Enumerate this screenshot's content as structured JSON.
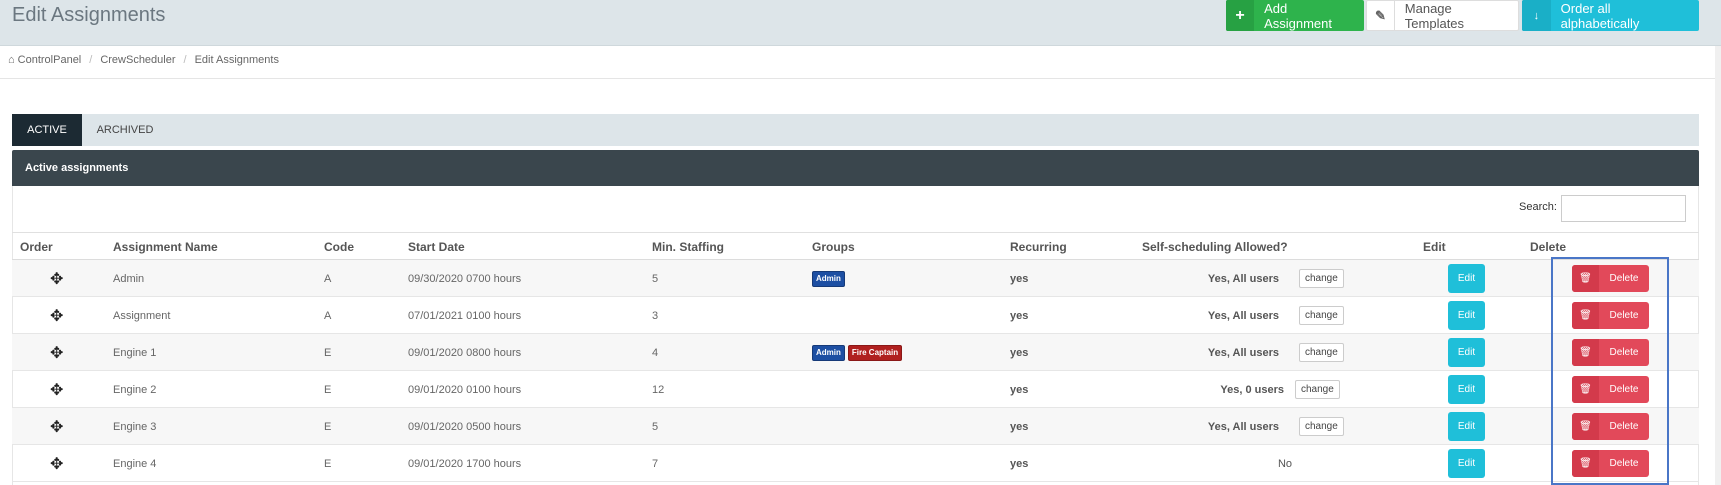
{
  "header": {
    "title": "Edit Assignments",
    "buttons": {
      "add_label": "Add Assignment",
      "manage_label": "Manage Templates",
      "order_label": "Order all alphabetically"
    }
  },
  "breadcrumb": [
    "ControlPanel",
    "CrewScheduler",
    "Edit Assignments"
  ],
  "tabs": [
    {
      "label": "ACTIVE",
      "active": true
    },
    {
      "label": "ARCHIVED",
      "active": false
    }
  ],
  "panel": {
    "title": "Active assignments",
    "search_label": "Search:",
    "search_value": ""
  },
  "table": {
    "columns": [
      "Order",
      "Assignment Name",
      "Code",
      "Start Date",
      "Min. Staffing",
      "Groups",
      "Recurring",
      "Self-scheduling Allowed?",
      "Edit",
      "Delete"
    ],
    "rows": [
      {
        "name": "Admin",
        "code": "A",
        "start": "09/30/2020 0700 hours",
        "staffing": "5",
        "groups": [
          "Admin"
        ],
        "recurring": "yes",
        "self": "Yes, All users",
        "change": "change",
        "edit": "Edit",
        "delete": "Delete"
      },
      {
        "name": "Assignment",
        "code": "A",
        "start": "07/01/2021 0100 hours",
        "staffing": "3",
        "groups": [],
        "recurring": "yes",
        "self": "Yes, All users",
        "change": "change",
        "edit": "Edit",
        "delete": "Delete"
      },
      {
        "name": "Engine 1",
        "code": "E",
        "start": "09/01/2020 0800 hours",
        "staffing": "4",
        "groups": [
          "Admin",
          "Fire Captain"
        ],
        "recurring": "yes",
        "self": "Yes, All users",
        "change": "change",
        "edit": "Edit",
        "delete": "Delete"
      },
      {
        "name": "Engine 2",
        "code": "E",
        "start": "09/01/2020 0100 hours",
        "staffing": "12",
        "groups": [],
        "recurring": "yes",
        "self": "Yes, 0 users",
        "change": "change",
        "edit": "Edit",
        "delete": "Delete"
      },
      {
        "name": "Engine 3",
        "code": "E",
        "start": "09/01/2020 0500 hours",
        "staffing": "5",
        "groups": [],
        "recurring": "yes",
        "self": "Yes, All users",
        "change": "change",
        "edit": "Edit",
        "delete": "Delete"
      },
      {
        "name": "Engine 4",
        "code": "E",
        "start": "09/01/2020 1700 hours",
        "staffing": "7",
        "groups": [],
        "recurring": "yes",
        "self": "No",
        "change": "",
        "edit": "Edit",
        "delete": "Delete"
      }
    ]
  },
  "colors": {
    "green": "#2eb34c",
    "cyan": "#1fbfd9",
    "red": "#e2495a",
    "dark_panel": "#3a464d",
    "admin_badge": "#1d4fa3",
    "fire_badge": "#b0201f",
    "highlight": "#4a76c7"
  },
  "icons": {
    "add": "plus-icon",
    "manage": "edit-icon",
    "order": "sort-alpha-icon",
    "home": "home-icon",
    "move": "move-icon",
    "delete": "trash-icon"
  }
}
